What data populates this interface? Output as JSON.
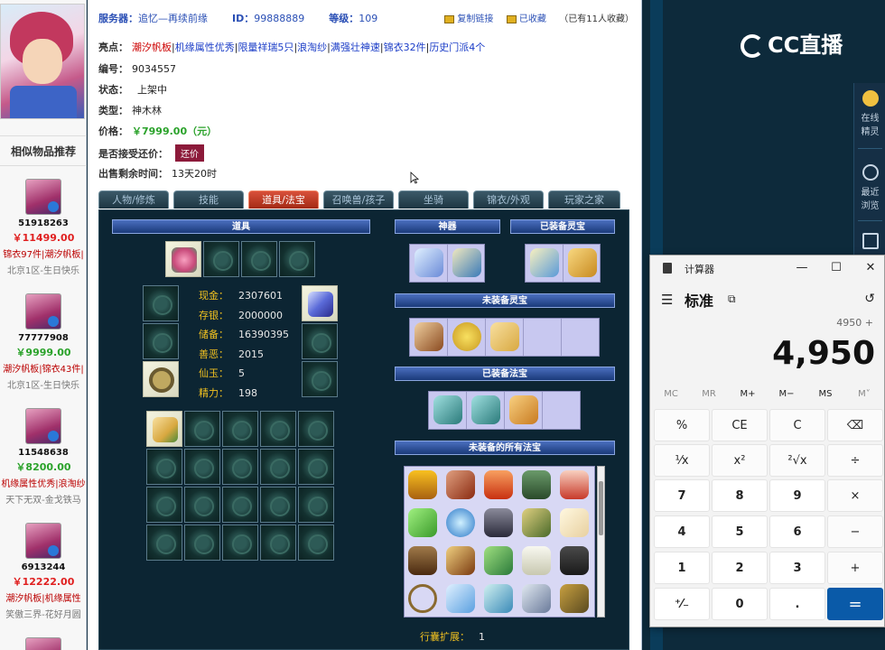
{
  "header": {
    "server_label": "服务器：",
    "server_value": "追忆—再续前缘",
    "id_label": "ID：",
    "id_value": "99888889",
    "level_label": "等级：",
    "level_value": "109",
    "copy_link": "复制链接",
    "favorited": "已收藏",
    "fav_count": "（已有11人收藏）"
  },
  "info": {
    "highlights_label": "亮点：",
    "highlights": [
      "潮汐帆板",
      "机缘属性优秀",
      "限量祥瑞5只",
      "浪淘纱",
      "满强壮神速",
      "锦衣32件",
      "历史门派4个"
    ],
    "sn_label": "编号：",
    "sn_value": "9034557",
    "status_label": "状态：",
    "status_value": "上架中",
    "type_label": "类型：",
    "type_value": "神木林",
    "price_label": "价格：",
    "price_value": "￥7999.00（元）",
    "counter_label": "是否接受还价：",
    "counter_button": "还价",
    "remain_label": "出售剩余时间：",
    "remain_value": "13天20时"
  },
  "tabs": [
    "人物/修炼",
    "技能",
    "道具/法宝",
    "召唤兽/孩子",
    "坐骑",
    "锦衣/外观",
    "玩家之家"
  ],
  "active_tab": "道具/法宝",
  "game": {
    "props_header": "道具",
    "artifact_header": "神器",
    "equipped_lingbao_header": "已装备灵宝",
    "unequipped_lingbao_header": "未装备灵宝",
    "equipped_fabao_header": "已装备法宝",
    "all_fabao_header": "未装备的所有法宝",
    "stats": [
      {
        "k": "现金：",
        "v": "2307601"
      },
      {
        "k": "存银：",
        "v": "2000000"
      },
      {
        "k": "储备：",
        "v": "16390395"
      },
      {
        "k": "善恶：",
        "v": "2015"
      },
      {
        "k": "仙玉：",
        "v": "5"
      },
      {
        "k": "精力：",
        "v": "198"
      }
    ],
    "bag_ext_label": "行囊扩展：",
    "bag_ext_value": "1"
  },
  "sidebar": {
    "title": "相似物品推荐",
    "items": [
      {
        "id": "51918263",
        "price": "￥11499.00",
        "tags": "锦衣97件|潮汐帆板|",
        "server": "北京1区-生日快乐",
        "price_color": "#e02020"
      },
      {
        "id": "77777908",
        "price": "￥9999.00",
        "tags": "潮汐帆板|锦衣43件|",
        "server": "北京1区-生日快乐",
        "price_color": "#2aa22a"
      },
      {
        "id": "11548638",
        "price": "￥8200.00",
        "tags": "机缘属性优秀|浪淘纱",
        "server": "天下无双-金戈铁马",
        "price_color": "#2aa22a"
      },
      {
        "id": "6913244",
        "price": "￥12222.00",
        "tags": "潮汐帆板|机缘属性",
        "server": "笑傲三界-花好月圆",
        "price_color": "#e02020"
      }
    ]
  },
  "right": {
    "logo": "CC直播",
    "tool_online": "在线\n精灵",
    "tool_recent": "最近\n浏览"
  },
  "calculator": {
    "title": "计算器",
    "mode": "标准",
    "expression": "4950 +",
    "display": "4,950",
    "memory": [
      "MC",
      "MR",
      "M+",
      "M−",
      "MS",
      "M˅"
    ],
    "keys": [
      [
        "%",
        "CE",
        "C",
        "⌫"
      ],
      [
        "¹⁄x",
        "x²",
        "²√x",
        "÷"
      ],
      [
        "7",
        "8",
        "9",
        "×"
      ],
      [
        "4",
        "5",
        "6",
        "−"
      ],
      [
        "1",
        "2",
        "3",
        "+"
      ],
      [
        "⁺⁄₋",
        "0",
        ".",
        "="
      ]
    ]
  }
}
